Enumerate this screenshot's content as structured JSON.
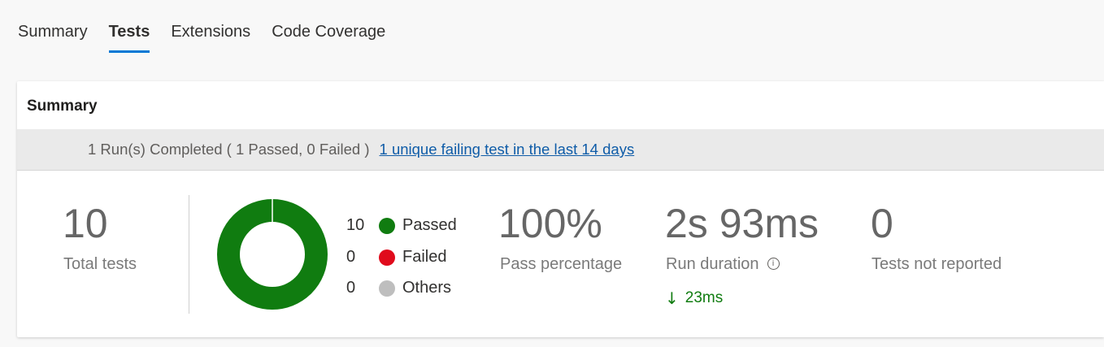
{
  "tabs": [
    {
      "label": "Summary",
      "active": false
    },
    {
      "label": "Tests",
      "active": true
    },
    {
      "label": "Extensions",
      "active": false
    },
    {
      "label": "Code Coverage",
      "active": false
    }
  ],
  "card": {
    "title": "Summary",
    "banner": {
      "status": "1 Run(s) Completed ( 1 Passed, 0 Failed )",
      "link": "1 unique failing test in the last 14 days"
    }
  },
  "metrics": {
    "total_tests": {
      "value": "10",
      "label": "Total tests"
    },
    "pass_percentage": {
      "value": "100%",
      "label": "Pass percentage"
    },
    "run_duration": {
      "value": "2s 93ms",
      "label": "Run duration",
      "delta": "23ms",
      "info_icon": "info-icon"
    },
    "not_reported": {
      "value": "0",
      "label": "Tests not reported"
    }
  },
  "legend": [
    {
      "count": "10",
      "label": "Passed",
      "color": "#107c10",
      "value": 10
    },
    {
      "count": "0",
      "label": "Failed",
      "color": "#e00b1c",
      "value": 0
    },
    {
      "count": "0",
      "label": "Others",
      "color": "#bebebe",
      "value": 0
    }
  ],
  "colors": {
    "accent": "#0078d4",
    "link": "#0f5ca8",
    "passed": "#107c10",
    "failed": "#e00b1c",
    "others": "#bebebe"
  }
}
